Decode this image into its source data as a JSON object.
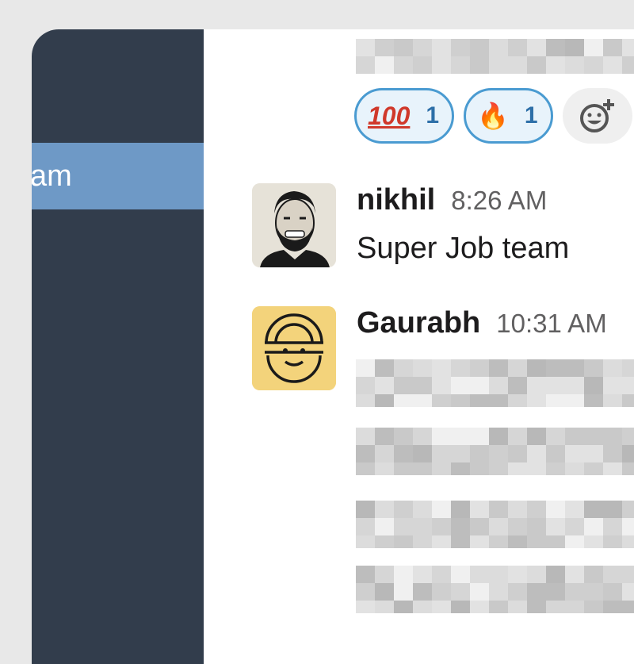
{
  "sidebar": {
    "selected_channel_label": "am",
    "colors": {
      "background": "#323d4c",
      "selected": "#6e99c6"
    }
  },
  "reactions": [
    {
      "emoji": "100",
      "icon": "hundred-points-emoji",
      "count": "1"
    },
    {
      "emoji": "🔥",
      "icon": "fire-emoji",
      "count": "1"
    }
  ],
  "add_reaction": {
    "icon": "add-reaction-smiley-icon"
  },
  "messages": [
    {
      "sender": "nikhil",
      "time": "8:26 AM",
      "text": "Super Job team",
      "avatar": "portrait-avatar"
    },
    {
      "sender": "Gaurabh",
      "time": "10:31 AM",
      "text": "",
      "avatar": "smiley-logo-avatar",
      "body_redacted": true
    }
  ],
  "colors": {
    "accent": "#4a9bd1",
    "reaction_bg": "#e8f3fb",
    "avatar_yellow": "#f3d37b"
  }
}
